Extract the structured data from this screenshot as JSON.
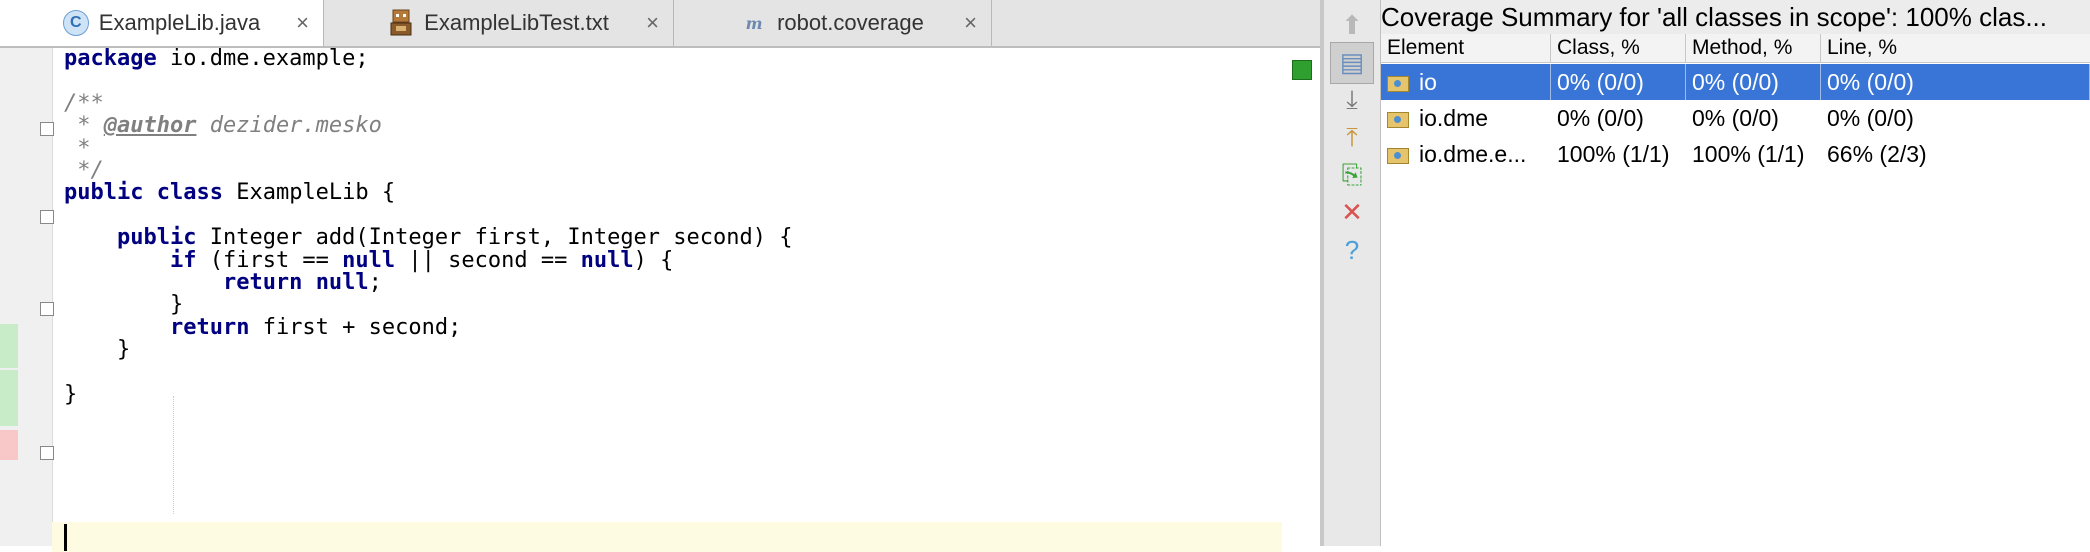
{
  "tabs": [
    {
      "label": "ExampleLib.java",
      "icon": "class-c-icon",
      "active": true
    },
    {
      "label": "ExampleLibTest.txt",
      "icon": "robot-icon",
      "active": false
    },
    {
      "label": "robot.coverage",
      "icon": "m-letter-icon",
      "active": false
    }
  ],
  "tab_icon_letters": {
    "class": "C",
    "m": "m"
  },
  "close_glyph": "×",
  "code": {
    "lines": [
      {
        "segs": [
          {
            "t": "package",
            "c": "kw"
          },
          {
            "t": " io.dme.example;",
            "c": ""
          }
        ]
      },
      {
        "segs": []
      },
      {
        "segs": [
          {
            "t": "/**",
            "c": "cm"
          }
        ]
      },
      {
        "segs": [
          {
            "t": " * ",
            "c": "cm"
          },
          {
            "t": "@author",
            "c": "tag"
          },
          {
            "t": " dezider.mesko",
            "c": "cm"
          }
        ]
      },
      {
        "segs": [
          {
            "t": " *",
            "c": "cm"
          }
        ]
      },
      {
        "segs": [
          {
            "t": " */",
            "c": "cm"
          }
        ]
      },
      {
        "segs": [
          {
            "t": "public",
            "c": "kw"
          },
          {
            "t": " ",
            "c": ""
          },
          {
            "t": "class",
            "c": "kw"
          },
          {
            "t": " ExampleLib {",
            "c": ""
          }
        ]
      },
      {
        "segs": []
      },
      {
        "segs": [
          {
            "t": "    ",
            "c": ""
          },
          {
            "t": "public",
            "c": "kw"
          },
          {
            "t": " Integer add(Integer first, Integer second) {",
            "c": ""
          }
        ]
      },
      {
        "segs": [
          {
            "t": "        ",
            "c": ""
          },
          {
            "t": "if",
            "c": "kw"
          },
          {
            "t": " (first == ",
            "c": ""
          },
          {
            "t": "null",
            "c": "kw"
          },
          {
            "t": " || second == ",
            "c": ""
          },
          {
            "t": "null",
            "c": "kw"
          },
          {
            "t": ") {",
            "c": ""
          }
        ]
      },
      {
        "segs": [
          {
            "t": "            ",
            "c": ""
          },
          {
            "t": "return",
            "c": "kw"
          },
          {
            "t": " ",
            "c": ""
          },
          {
            "t": "null",
            "c": "kw"
          },
          {
            "t": ";",
            "c": ""
          }
        ]
      },
      {
        "segs": [
          {
            "t": "        }",
            "c": ""
          }
        ]
      },
      {
        "segs": [
          {
            "t": "        ",
            "c": ""
          },
          {
            "t": "return",
            "c": "kw"
          },
          {
            "t": " first + second;",
            "c": ""
          }
        ]
      },
      {
        "segs": [
          {
            "t": "    }",
            "c": ""
          }
        ]
      },
      {
        "segs": []
      },
      {
        "segs": [
          {
            "t": "}",
            "c": ""
          }
        ]
      }
    ]
  },
  "coverage": {
    "title": "Coverage Summary for 'all classes in scope': 100% clas...",
    "columns": [
      "Element",
      "Class, %",
      "Method, %",
      "Line, %"
    ],
    "rows": [
      {
        "element": "io",
        "class": "0% (0/0)",
        "method": "0% (0/0)",
        "line": "0% (0/0)",
        "selected": true
      },
      {
        "element": "io.dme",
        "class": "0% (0/0)",
        "method": "0% (0/0)",
        "line": "0% (0/0)",
        "selected": false
      },
      {
        "element": "io.dme.e...",
        "class": "100% (1/1)",
        "method": "100% (1/1)",
        "line": "66% (2/3)",
        "selected": false
      }
    ]
  },
  "toolbar": [
    {
      "name": "up-arrow-icon",
      "glyph": "⬆",
      "color": "#b8b8b8"
    },
    {
      "name": "flatten-packages-icon",
      "glyph": "▤",
      "color": "#6a8fbf"
    },
    {
      "name": "autoscroll-to-source-icon",
      "glyph": "⤓",
      "color": "#7a7a7a"
    },
    {
      "name": "autoscroll-from-source-icon",
      "glyph": "⤒",
      "color": "#c8963a"
    },
    {
      "name": "export-report-icon",
      "glyph": "⎘",
      "color": "#3aa33a"
    },
    {
      "name": "close-icon",
      "glyph": "✕",
      "color": "#d9534f"
    },
    {
      "name": "help-icon",
      "glyph": "?",
      "color": "#4a9fd9"
    }
  ],
  "colors": {
    "selection": "#3875d7",
    "keyword": "#000080",
    "covered": "#c8ecc8",
    "uncovered": "#f8c8c8"
  }
}
